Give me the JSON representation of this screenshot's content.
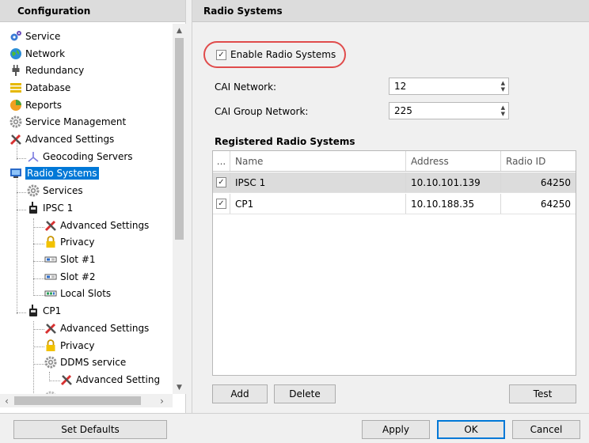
{
  "left": {
    "title": "Configuration",
    "tree": [
      {
        "label": "Service",
        "icon": "gears-icon"
      },
      {
        "label": "Network",
        "icon": "globe-icon"
      },
      {
        "label": "Redundancy",
        "icon": "plug-icon"
      },
      {
        "label": "Database",
        "icon": "database-icon"
      },
      {
        "label": "Reports",
        "icon": "reports-icon"
      },
      {
        "label": "Service Management",
        "icon": "gear-icon"
      },
      {
        "label": "Advanced Settings",
        "icon": "tools-icon"
      },
      {
        "label": "Geocoding Servers",
        "icon": "geocoding-icon"
      },
      {
        "label": "Radio Systems",
        "icon": "radio-systems-icon"
      },
      {
        "label": "Services",
        "icon": "gear-icon"
      },
      {
        "label": "IPSC 1",
        "icon": "radio-icon"
      },
      {
        "label": "Advanced Settings",
        "icon": "tools-icon"
      },
      {
        "label": "Privacy",
        "icon": "lock-icon"
      },
      {
        "label": "Slot #1",
        "icon": "slot-icon"
      },
      {
        "label": "Slot #2",
        "icon": "slot-icon"
      },
      {
        "label": "Local Slots",
        "icon": "local-slots-icon"
      },
      {
        "label": "CP1",
        "icon": "radio-icon"
      },
      {
        "label": "Advanced Settings",
        "icon": "tools-icon"
      },
      {
        "label": "Privacy",
        "icon": "lock-icon"
      },
      {
        "label": "DDMS service",
        "icon": "gear-icon"
      },
      {
        "label": "Advanced Setting",
        "icon": "tools-icon"
      }
    ]
  },
  "right": {
    "title": "Radio Systems",
    "enable_label": "Enable Radio Systems",
    "cai_network_label": "CAI Network:",
    "cai_network_value": "12",
    "cai_group_label": "CAI Group Network:",
    "cai_group_value": "225",
    "registered_title": "Registered Radio Systems",
    "grid": {
      "headers": [
        "...",
        "Name",
        "Address",
        "Radio ID"
      ],
      "rows": [
        {
          "name": "IPSC 1",
          "address": "10.10.101.139",
          "radio_id": "64250"
        },
        {
          "name": "CP1",
          "address": "10.10.188.35",
          "radio_id": "64250"
        }
      ]
    },
    "add_label": "Add",
    "delete_label": "Delete",
    "test_label": "Test"
  },
  "bottom": {
    "set_defaults_label": "Set Defaults",
    "apply_label": "Apply",
    "ok_label": "OK",
    "cancel_label": "Cancel"
  },
  "colors": {
    "selection": "#0078d7",
    "highlight_ring": "#e04b4b"
  }
}
